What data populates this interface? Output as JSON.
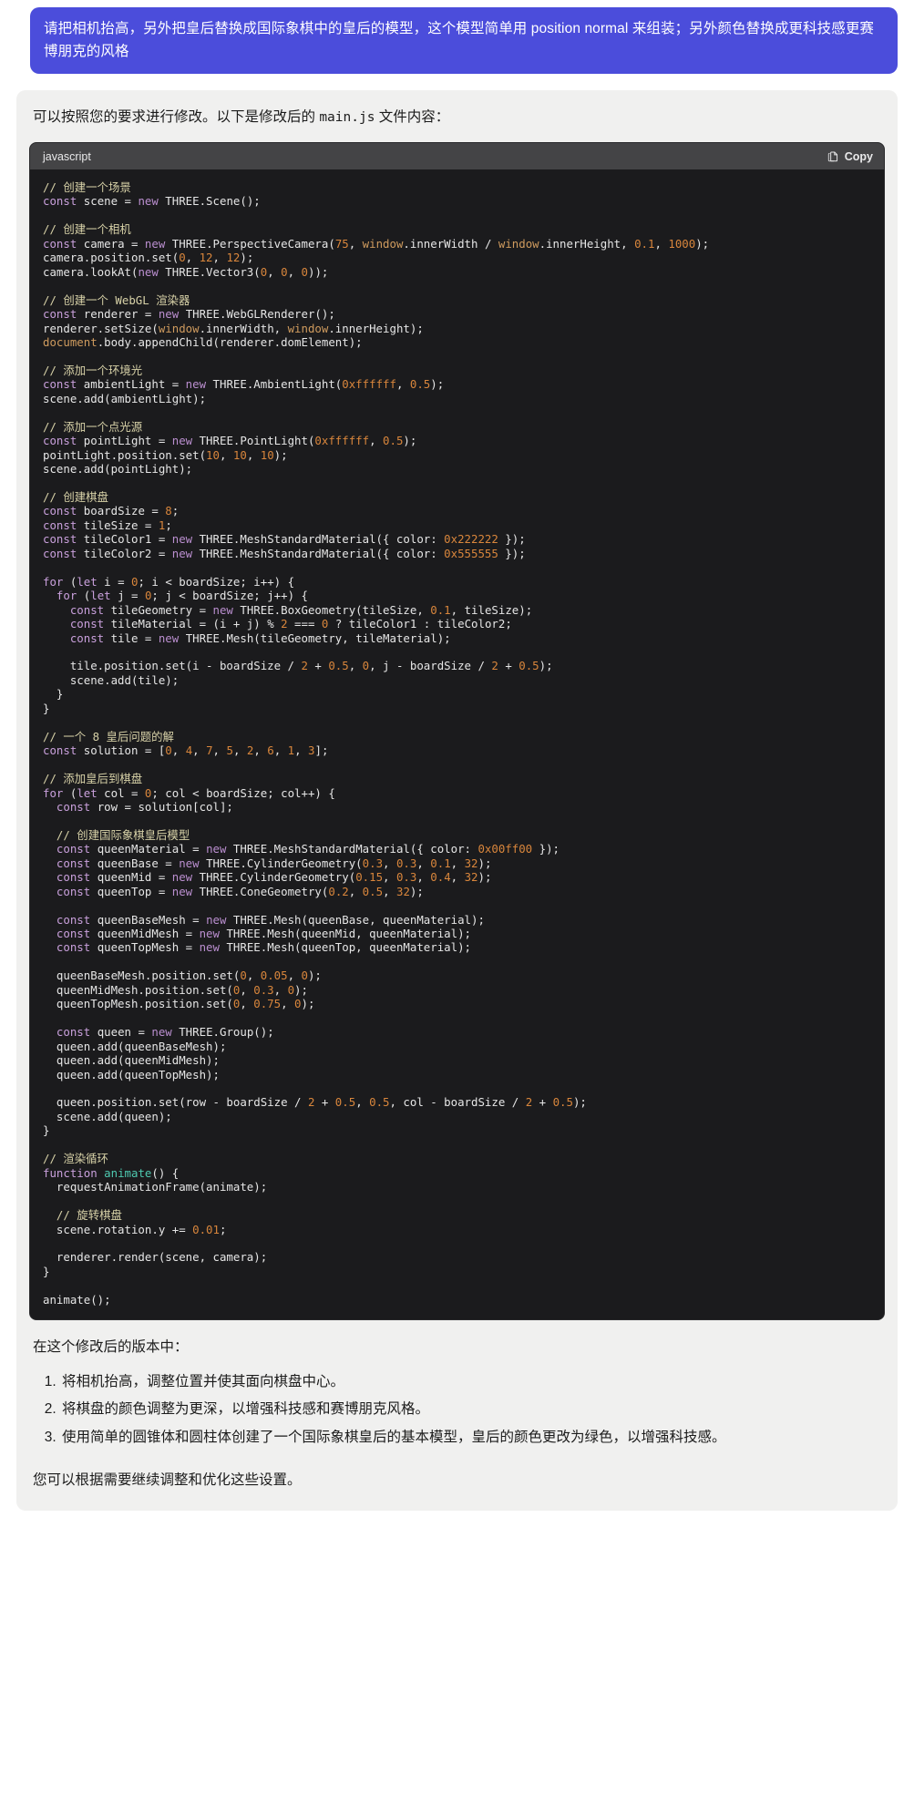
{
  "user_message": {
    "text": "请把相机抬高，另外把皇后替换成国际象棋中的皇后的模型，这个模型简单用 position normal 来组装；另外颜色替换成更科技感更赛博朋克的风格",
    "bubble_color": "#4b4ddb"
  },
  "assistant": {
    "intro_before": "可以按照您的要求进行修改。以下是修改后的 ",
    "intro_code": "main.js",
    "intro_after": " 文件内容：",
    "code_block": {
      "language": "javascript",
      "copy_label": "Copy",
      "background": "#1b1b1d",
      "header_background": "#444446",
      "lines": [
        {
          "t": "comment",
          "text": "// 创建一个场景"
        },
        {
          "t": "code",
          "text": "const scene = new THREE.Scene();"
        },
        {
          "t": "blank",
          "text": ""
        },
        {
          "t": "comment",
          "text": "// 创建一个相机"
        },
        {
          "t": "code",
          "text": "const camera = new THREE.PerspectiveCamera(75, window.innerWidth / window.innerHeight, 0.1, 1000);"
        },
        {
          "t": "code",
          "text": "camera.position.set(0, 12, 12);"
        },
        {
          "t": "code",
          "text": "camera.lookAt(new THREE.Vector3(0, 0, 0));"
        },
        {
          "t": "blank",
          "text": ""
        },
        {
          "t": "comment",
          "text": "// 创建一个 WebGL 渲染器"
        },
        {
          "t": "code",
          "text": "const renderer = new THREE.WebGLRenderer();"
        },
        {
          "t": "code",
          "text": "renderer.setSize(window.innerWidth, window.innerHeight);"
        },
        {
          "t": "code",
          "text": "document.body.appendChild(renderer.domElement);"
        },
        {
          "t": "blank",
          "text": ""
        },
        {
          "t": "comment",
          "text": "// 添加一个环境光"
        },
        {
          "t": "code",
          "text": "const ambientLight = new THREE.AmbientLight(0xffffff, 0.5);"
        },
        {
          "t": "code",
          "text": "scene.add(ambientLight);"
        },
        {
          "t": "blank",
          "text": ""
        },
        {
          "t": "comment",
          "text": "// 添加一个点光源"
        },
        {
          "t": "code",
          "text": "const pointLight = new THREE.PointLight(0xffffff, 0.5);"
        },
        {
          "t": "code",
          "text": "pointLight.position.set(10, 10, 10);"
        },
        {
          "t": "code",
          "text": "scene.add(pointLight);"
        },
        {
          "t": "blank",
          "text": ""
        },
        {
          "t": "comment",
          "text": "// 创建棋盘"
        },
        {
          "t": "code",
          "text": "const boardSize = 8;"
        },
        {
          "t": "code",
          "text": "const tileSize = 1;"
        },
        {
          "t": "code",
          "text": "const tileColor1 = new THREE.MeshStandardMaterial({ color: 0x222222 });"
        },
        {
          "t": "code",
          "text": "const tileColor2 = new THREE.MeshStandardMaterial({ color: 0x555555 });"
        },
        {
          "t": "blank",
          "text": ""
        },
        {
          "t": "code",
          "text": "for (let i = 0; i < boardSize; i++) {"
        },
        {
          "t": "code",
          "text": "  for (let j = 0; j < boardSize; j++) {"
        },
        {
          "t": "code",
          "text": "    const tileGeometry = new THREE.BoxGeometry(tileSize, 0.1, tileSize);"
        },
        {
          "t": "code",
          "text": "    const tileMaterial = (i + j) % 2 === 0 ? tileColor1 : tileColor2;"
        },
        {
          "t": "code",
          "text": "    const tile = new THREE.Mesh(tileGeometry, tileMaterial);"
        },
        {
          "t": "blank",
          "text": ""
        },
        {
          "t": "code",
          "text": "    tile.position.set(i - boardSize / 2 + 0.5, 0, j - boardSize / 2 + 0.5);"
        },
        {
          "t": "code",
          "text": "    scene.add(tile);"
        },
        {
          "t": "code",
          "text": "  }"
        },
        {
          "t": "code",
          "text": "}"
        },
        {
          "t": "blank",
          "text": ""
        },
        {
          "t": "comment",
          "text": "// 一个 8 皇后问题的解"
        },
        {
          "t": "code",
          "text": "const solution = [0, 4, 7, 5, 2, 6, 1, 3];"
        },
        {
          "t": "blank",
          "text": ""
        },
        {
          "t": "comment",
          "text": "// 添加皇后到棋盘"
        },
        {
          "t": "code",
          "text": "for (let col = 0; col < boardSize; col++) {"
        },
        {
          "t": "code",
          "text": "  const row = solution[col];"
        },
        {
          "t": "blank",
          "text": ""
        },
        {
          "t": "comment",
          "text": "  // 创建国际象棋皇后模型"
        },
        {
          "t": "code",
          "text": "  const queenMaterial = new THREE.MeshStandardMaterial({ color: 0x00ff00 });"
        },
        {
          "t": "code",
          "text": "  const queenBase = new THREE.CylinderGeometry(0.3, 0.3, 0.1, 32);"
        },
        {
          "t": "code",
          "text": "  const queenMid = new THREE.CylinderGeometry(0.15, 0.3, 0.4, 32);"
        },
        {
          "t": "code",
          "text": "  const queenTop = new THREE.ConeGeometry(0.2, 0.5, 32);"
        },
        {
          "t": "blank",
          "text": ""
        },
        {
          "t": "code",
          "text": "  const queenBaseMesh = new THREE.Mesh(queenBase, queenMaterial);"
        },
        {
          "t": "code",
          "text": "  const queenMidMesh = new THREE.Mesh(queenMid, queenMaterial);"
        },
        {
          "t": "code",
          "text": "  const queenTopMesh = new THREE.Mesh(queenTop, queenMaterial);"
        },
        {
          "t": "blank",
          "text": ""
        },
        {
          "t": "code",
          "text": "  queenBaseMesh.position.set(0, 0.05, 0);"
        },
        {
          "t": "code",
          "text": "  queenMidMesh.position.set(0, 0.3, 0);"
        },
        {
          "t": "code",
          "text": "  queenTopMesh.position.set(0, 0.75, 0);"
        },
        {
          "t": "blank",
          "text": ""
        },
        {
          "t": "code",
          "text": "  const queen = new THREE.Group();"
        },
        {
          "t": "code",
          "text": "  queen.add(queenBaseMesh);"
        },
        {
          "t": "code",
          "text": "  queen.add(queenMidMesh);"
        },
        {
          "t": "code",
          "text": "  queen.add(queenTopMesh);"
        },
        {
          "t": "blank",
          "text": ""
        },
        {
          "t": "code",
          "text": "  queen.position.set(row - boardSize / 2 + 0.5, 0.5, col - boardSize / 2 + 0.5);"
        },
        {
          "t": "code",
          "text": "  scene.add(queen);"
        },
        {
          "t": "code",
          "text": "}"
        },
        {
          "t": "blank",
          "text": ""
        },
        {
          "t": "comment",
          "text": "// 渲染循环"
        },
        {
          "t": "code",
          "text": "function animate() {"
        },
        {
          "t": "code",
          "text": "  requestAnimationFrame(animate);"
        },
        {
          "t": "blank",
          "text": ""
        },
        {
          "t": "comment",
          "text": "  // 旋转棋盘"
        },
        {
          "t": "code",
          "text": "  scene.rotation.y += 0.01;"
        },
        {
          "t": "blank",
          "text": ""
        },
        {
          "t": "code",
          "text": "  renderer.render(scene, camera);"
        },
        {
          "t": "code",
          "text": "}"
        },
        {
          "t": "blank",
          "text": ""
        },
        {
          "t": "code",
          "text": "animate();"
        }
      ]
    },
    "after_heading": "在这个修改后的版本中：",
    "changes": [
      "将相机抬高，调整位置并使其面向棋盘中心。",
      "将棋盘的颜色调整为更深，以增强科技感和赛博朋克风格。",
      "使用简单的圆锥体和圆柱体创建了一个国际象棋皇后的基本模型，皇后的颜色更改为绿色，以增强科技感。"
    ],
    "closing": "您可以根据需要继续调整和优化这些设置。"
  }
}
